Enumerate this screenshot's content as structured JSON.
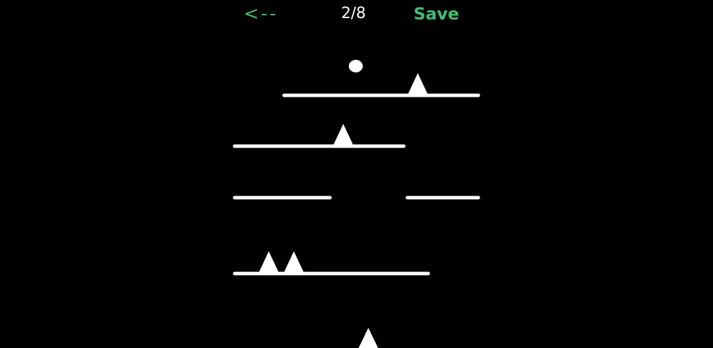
{
  "topbar": {
    "back_label": "<--",
    "progress": "2/8",
    "save_label": "Save"
  },
  "colors": {
    "background": "#000000",
    "accent": "#3fbf74",
    "foreground": "#ffffff"
  },
  "level": {
    "current": 2,
    "total": 8
  }
}
